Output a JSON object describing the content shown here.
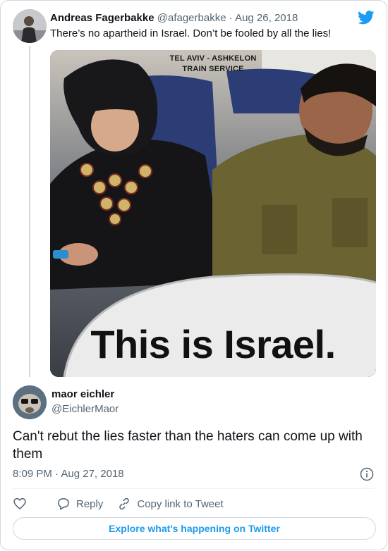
{
  "parent_tweet": {
    "author_name": "Andreas Fagerbakke",
    "author_handle": "@afagerbakke",
    "separator": "·",
    "date": "Aug 26, 2018",
    "text": "There’s no apartheid in Israel. Don’t be fooled by all the lies!",
    "media": {
      "sign_line1": "TEL AVIV - ASHKELON",
      "sign_line2": "TRAIN SERVICE",
      "caption": "This is Israel."
    }
  },
  "tweet": {
    "author_name": "maor eichler",
    "author_handle": "@EichlerMaor",
    "text": "Can't rebut the lies faster than the haters can come up with them",
    "time": "8:09 PM",
    "separator": "·",
    "date": "Aug 27, 2018"
  },
  "actions": {
    "reply_label": "Reply",
    "copy_link_label": "Copy link to Tweet"
  },
  "footer": {
    "explore_label": "Explore what's happening on Twitter"
  },
  "icons": {
    "brand": "twitter-bird-icon",
    "info": "info-icon",
    "like": "heart-icon",
    "reply": "reply-bubble-icon",
    "link": "link-icon"
  },
  "colors": {
    "brand_blue": "#1d9bf0",
    "secondary_text": "#536471",
    "border": "#cfd9de",
    "primary_text": "#0f1419"
  }
}
